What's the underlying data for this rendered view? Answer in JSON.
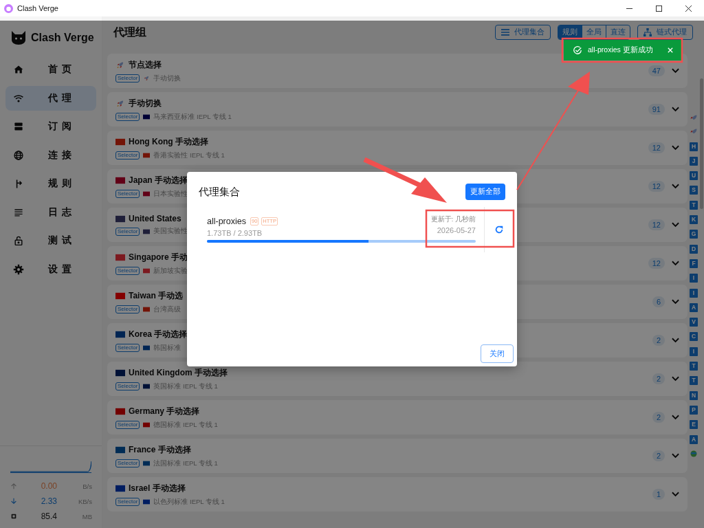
{
  "window": {
    "title": "Clash Verge"
  },
  "sidebar": {
    "logo": "Clash Verge",
    "items": [
      {
        "label": "首页",
        "kind": "home",
        "selected": false
      },
      {
        "label": "代理",
        "kind": "wifi",
        "selected": true
      },
      {
        "label": "订阅",
        "kind": "server",
        "selected": false
      },
      {
        "label": "连接",
        "kind": "globe",
        "selected": false
      },
      {
        "label": "规则",
        "kind": "fork",
        "selected": false
      },
      {
        "label": "日志",
        "kind": "lines",
        "selected": false
      },
      {
        "label": "测试",
        "kind": "lock",
        "selected": false
      },
      {
        "label": "设置",
        "kind": "gear",
        "selected": false
      }
    ],
    "traffic": [
      {
        "kind": "up",
        "value": "0.00",
        "unit": "B/s"
      },
      {
        "kind": "down",
        "value": "2.33",
        "unit": "KB/s"
      },
      {
        "kind": "memory",
        "value": "85.4",
        "unit": "MB"
      }
    ]
  },
  "header": {
    "title": "代理组",
    "providers_button": "代理集合",
    "modes": [
      {
        "label": "规则",
        "selected": true
      },
      {
        "label": "全局",
        "selected": false
      },
      {
        "label": "直连",
        "selected": false
      }
    ],
    "chain_button": "链式代理"
  },
  "groups": [
    {
      "name": "节点选择",
      "icon": {
        "kind": "rocket"
      },
      "type": "Selector",
      "sub_icon": {
        "kind": "rocket"
      },
      "current": "手动切换",
      "count": "47"
    },
    {
      "name": "手动切换",
      "icon": {
        "kind": "rocket"
      },
      "type": "Selector",
      "sub_icon": {
        "kind": "flag",
        "color": "#000035"
      },
      "current": "马来西亚标准 IEPL 专线 1",
      "count": "91"
    },
    {
      "name": "Hong Kong 手动选择",
      "icon": {
        "kind": "flag",
        "color": "#731508"
      },
      "type": "Selector",
      "sub_icon": {
        "kind": "flag",
        "color": "#731508"
      },
      "current": "香港实验性 IEPL 专线 1",
      "count": "12"
    },
    {
      "name": "Japan 手动选择",
      "icon": {
        "kind": "flag",
        "color": "#620017"
      },
      "type": "Selector",
      "sub_icon": {
        "kind": "flag",
        "color": "#620017"
      },
      "current": "日本实验性",
      "count": "12"
    },
    {
      "name": "United States",
      "icon": {
        "kind": "flag",
        "color": "#1f1f39"
      },
      "type": "Selector",
      "sub_icon": {
        "kind": "flag",
        "color": "#1f1f39"
      },
      "current": "美国实验性",
      "count": "12"
    },
    {
      "name": "Singapore 手动",
      "icon": {
        "kind": "flag",
        "color": "#7c1a21"
      },
      "type": "Selector",
      "sub_icon": {
        "kind": "flag",
        "color": "#7c1a21"
      },
      "current": "新加坡实验",
      "count": "12"
    },
    {
      "name": "Taiwan 手动选",
      "icon": {
        "kind": "flag",
        "color": "#840000"
      },
      "type": "Selector",
      "sub_icon": {
        "kind": "flag",
        "color": "#731508"
      },
      "current": "台湾高级",
      "count": "6"
    },
    {
      "name": "Korea 手动选择",
      "icon": {
        "kind": "flag",
        "color": "#002553"
      },
      "type": "Selector",
      "sub_icon": {
        "kind": "flag",
        "color": "#002553"
      },
      "current": "韩国标准",
      "count": "2"
    },
    {
      "name": "United Kingdom 手动选择",
      "icon": {
        "kind": "flag",
        "color": "#001136"
      },
      "type": "Selector",
      "sub_icon": {
        "kind": "flag",
        "color": "#001136"
      },
      "current": "英国标准 IEPL 专线 1",
      "count": "2"
    },
    {
      "name": "Germany 手动选择",
      "icon": {
        "kind": "flag",
        "color": "#730000"
      },
      "type": "Selector",
      "sub_icon": {
        "kind": "flag",
        "color": "#730000"
      },
      "current": "德国标准 IEPL 专线 1",
      "count": "2"
    },
    {
      "name": "France 手动选择",
      "icon": {
        "kind": "flag",
        "color": "#002c55"
      },
      "type": "Selector",
      "sub_icon": {
        "kind": "flag",
        "color": "#002c55"
      },
      "current": "法国标准 IEPL 专线 1",
      "count": "2"
    },
    {
      "name": "Israel 手动选择",
      "icon": {
        "kind": "flag",
        "color": "#001d60"
      },
      "type": "Selector",
      "sub_icon": {
        "kind": "flag",
        "color": "#001d60"
      },
      "current": "以色列标准 IEPL 专线 1",
      "count": "1"
    }
  ],
  "index_letters": [
    "H",
    "J",
    "U",
    "S",
    "T",
    "K",
    "G",
    "D",
    "F",
    "I",
    "I",
    "A",
    "V",
    "C",
    "I",
    "T",
    "T",
    "N",
    "P",
    "E",
    "A"
  ],
  "dialog": {
    "title": "代理集合",
    "update_all": "更新全部",
    "providers": [
      {
        "name": "all-proxies",
        "count": "90",
        "type": "HTTP",
        "usage": "1.73TB / 2.93TB",
        "level": 0.6,
        "updated": "更新于: 几秒前",
        "date": "2026-05-27"
      }
    ],
    "close": "关闭"
  },
  "toast": {
    "message": "all-proxies 更新成功"
  }
}
